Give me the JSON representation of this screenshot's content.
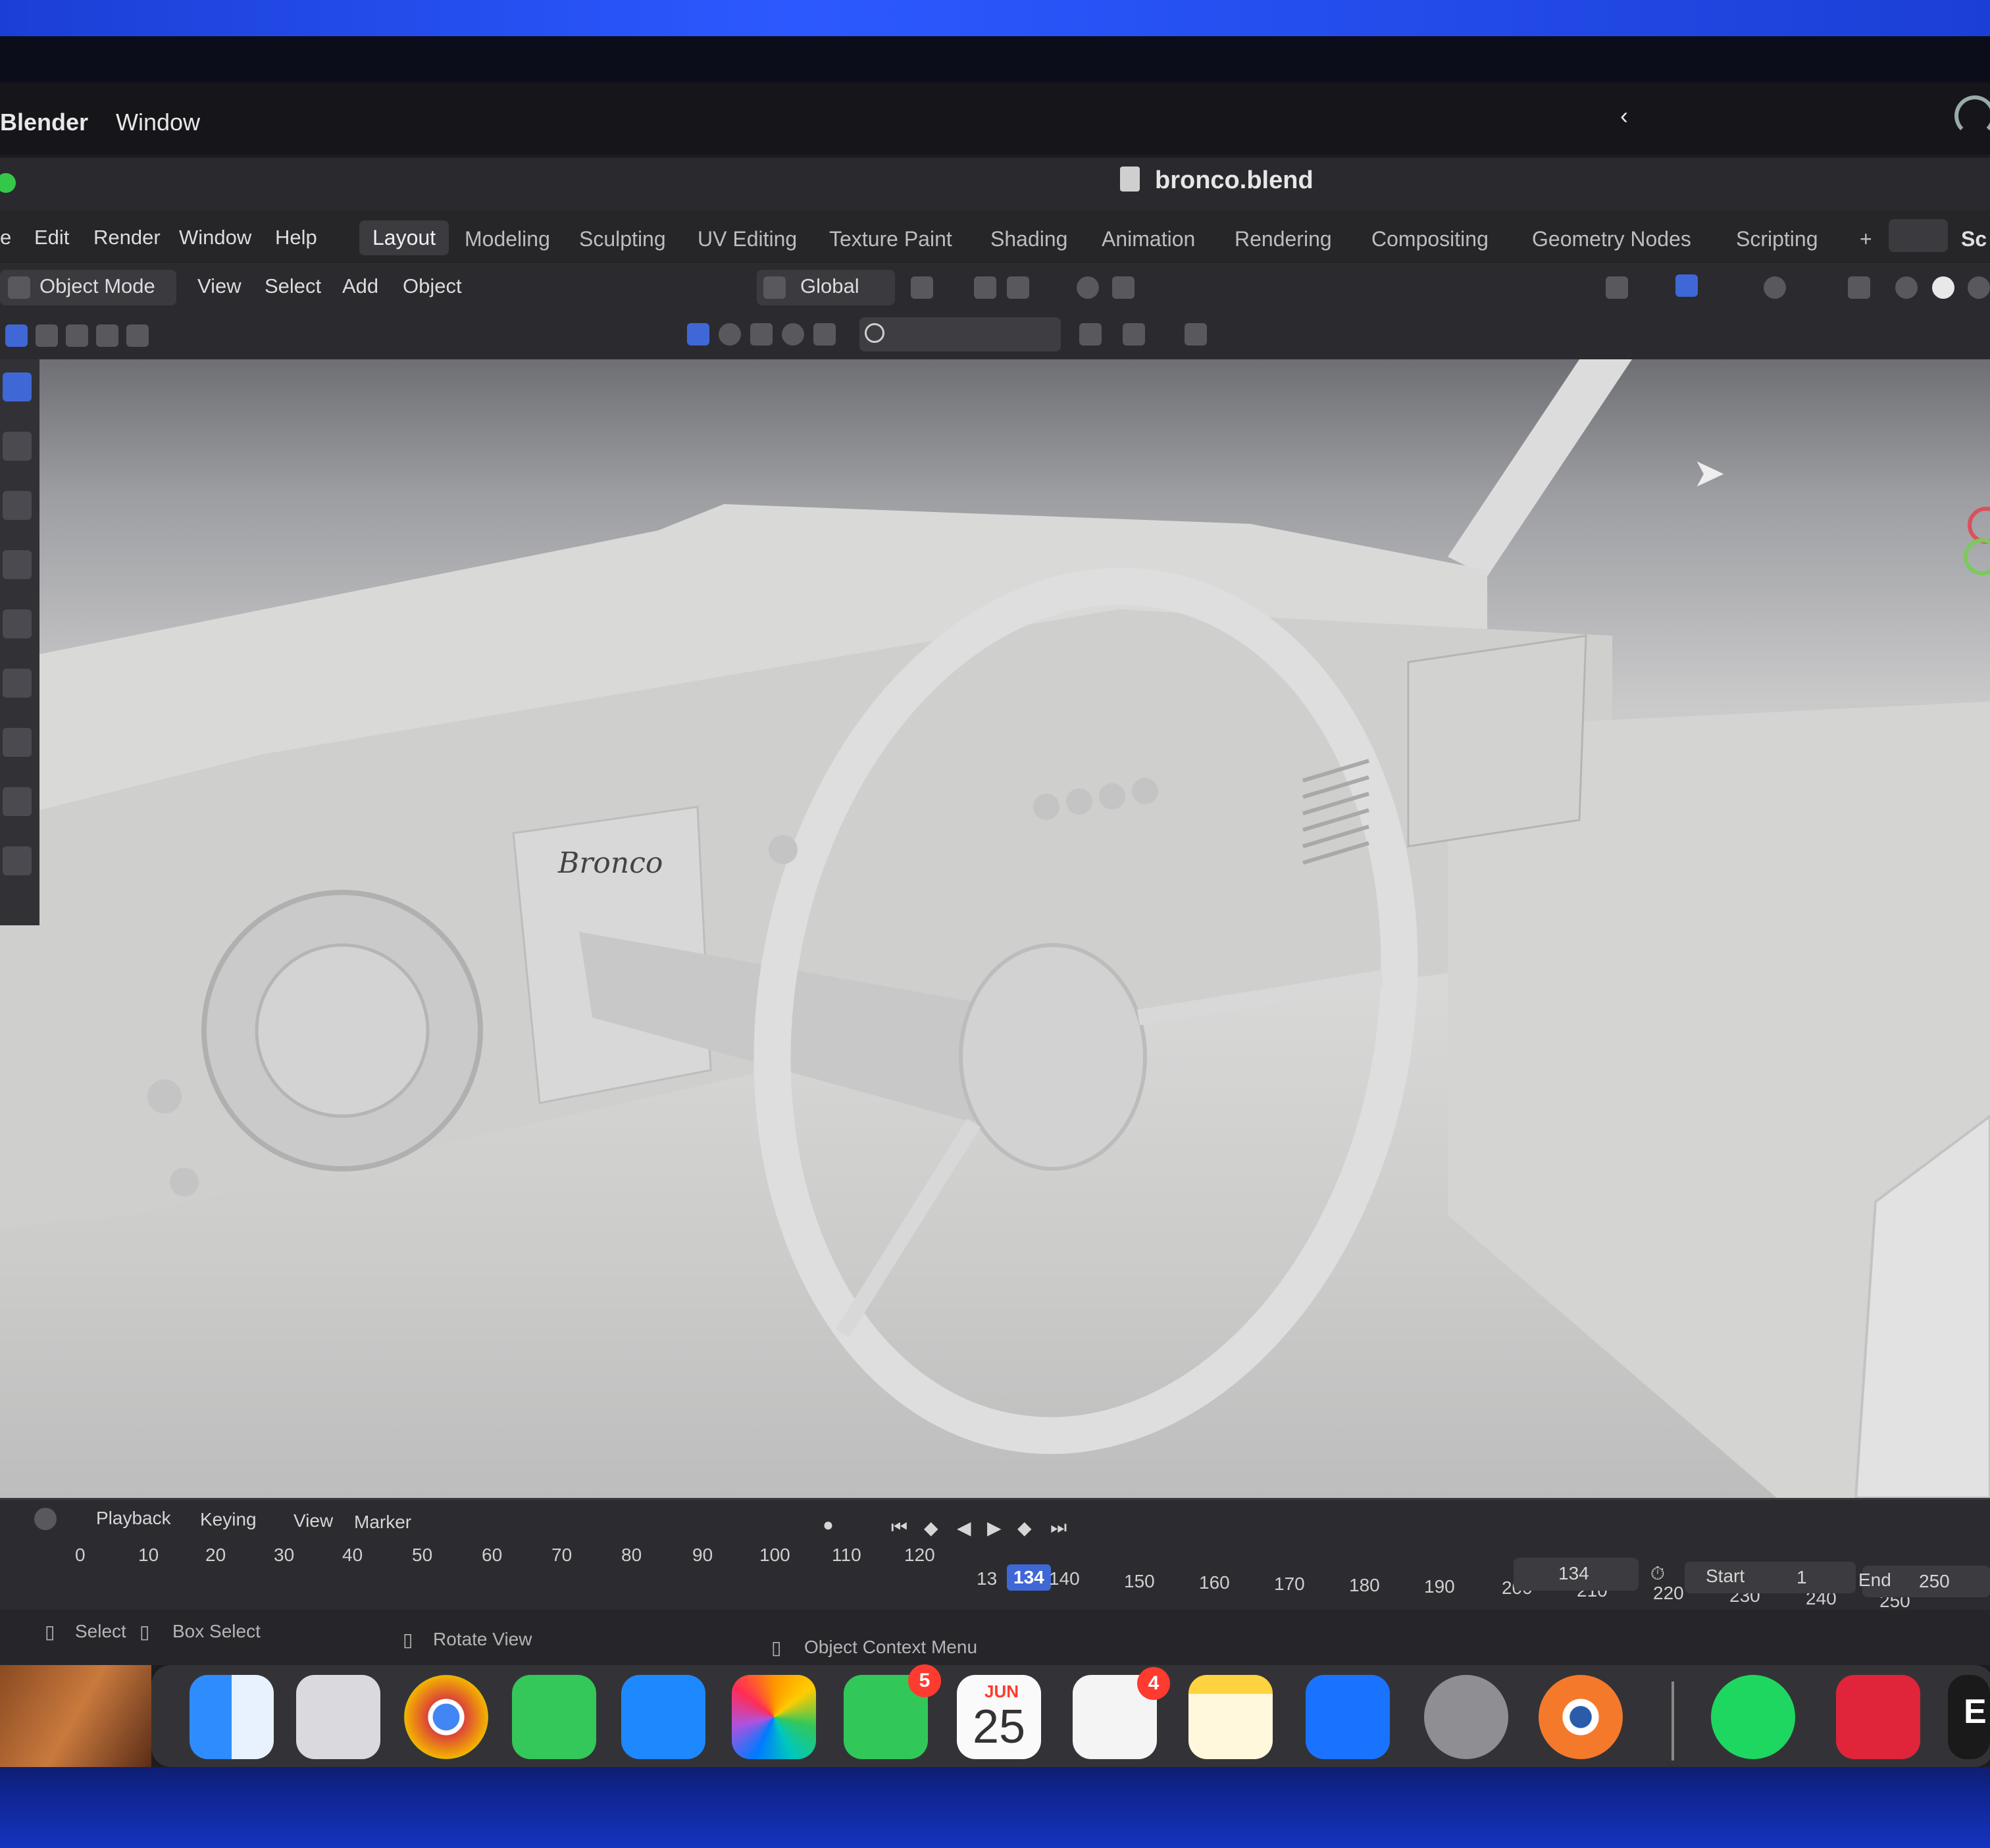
{
  "macos_menubar": {
    "app": "Blender",
    "window": "Window",
    "chevron": "‹"
  },
  "title": "bronco.blend",
  "menu": [
    "e",
    "Edit",
    "Render",
    "Window",
    "Help"
  ],
  "workspaces": [
    "Layout",
    "Modeling",
    "Sculpting",
    "UV Editing",
    "Texture Paint",
    "Shading",
    "Animation",
    "Rendering",
    "Compositing",
    "Geometry Nodes",
    "Scripting",
    "+",
    "Sc"
  ],
  "header": {
    "mode": "Object Mode",
    "view": "View",
    "select": "Select",
    "add": "Add",
    "object": "Object",
    "transform_orientation": "Global"
  },
  "viewport": {
    "emblem": "Bronco"
  },
  "timeline": {
    "menu": [
      "Playback",
      "Keying",
      "View",
      "Marker"
    ],
    "ticks": [
      "0",
      "10",
      "20",
      "30",
      "40",
      "50",
      "60",
      "70",
      "80",
      "90",
      "100",
      "110",
      "120",
      "13",
      "140",
      "150",
      "160",
      "170",
      "180",
      "190",
      "200",
      "210",
      "220",
      "230",
      "240",
      "250"
    ],
    "current_frame": "134",
    "frame_field": "134",
    "start_label": "Start",
    "start": "1",
    "end_label": "End",
    "end": "250"
  },
  "status": {
    "select": "Select",
    "box_select": "Box Select",
    "rotate": "Rotate View",
    "context": "Object Context Menu"
  },
  "dock": {
    "calendar_month": "JUN",
    "calendar_day": "25",
    "facetime_badge": "5",
    "reminders_badge": "4",
    "partial_label": "E"
  },
  "colors": {
    "accent": "#3f68d6",
    "ui_bg": "#2b2b2f",
    "badge": "#ff3b30"
  }
}
